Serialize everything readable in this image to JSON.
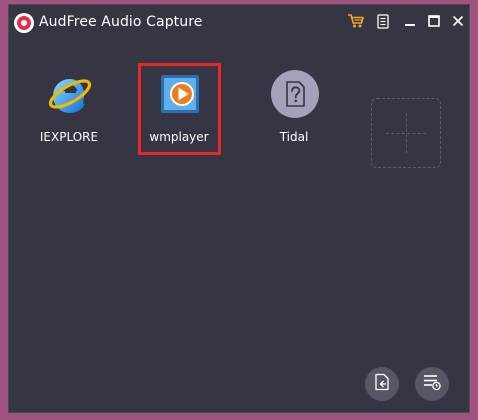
{
  "window": {
    "title": "AudFree Audio Capture"
  },
  "titlebar": {
    "icons": [
      "shopping-cart-icon",
      "menu-icon",
      "minimize-icon",
      "maximize-icon",
      "close-icon"
    ]
  },
  "apps": [
    {
      "label": "IEXPLORE",
      "icon": "internet-explorer-icon"
    },
    {
      "label": "wmplayer",
      "icon": "windows-media-player-icon",
      "selected": true
    },
    {
      "label": "Tidal",
      "icon": "unknown-app-icon"
    }
  ],
  "add_slot": {
    "icon": "add-plus-icon"
  },
  "footer": {
    "icons": [
      "output-folder-icon",
      "history-list-icon"
    ]
  },
  "colors": {
    "window_bg": "#363543",
    "desktop_bg": "#a0537e",
    "accent_cart": "#f5a623",
    "selection_border": "#e8262c",
    "round_button_bg": "#575665"
  }
}
